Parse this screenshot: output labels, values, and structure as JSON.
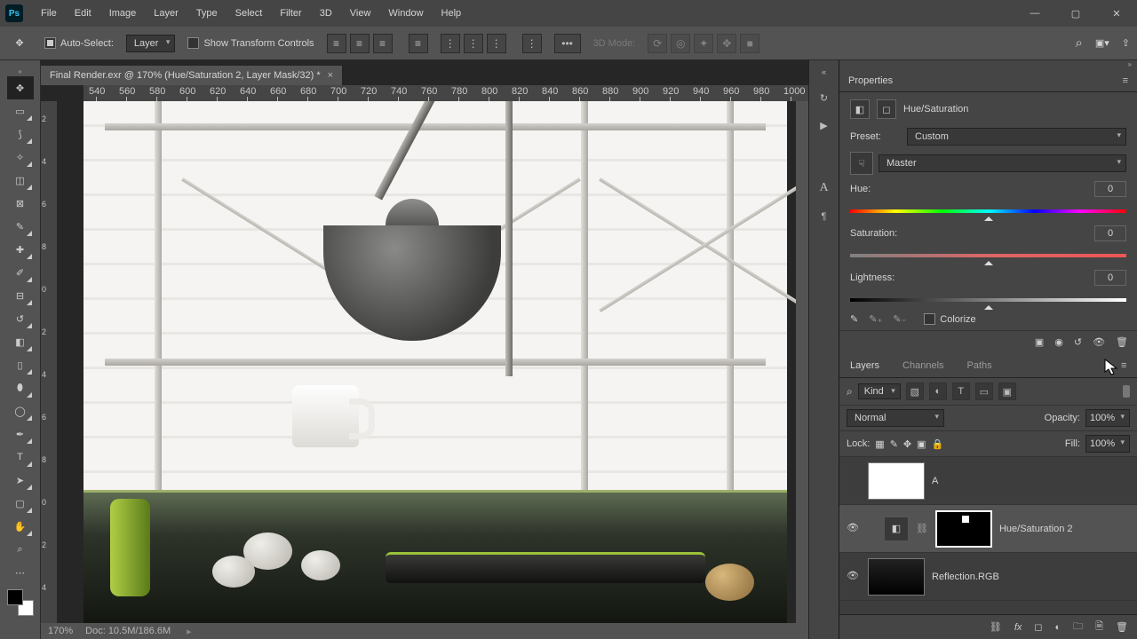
{
  "menubar": [
    "File",
    "Edit",
    "Image",
    "Layer",
    "Type",
    "Select",
    "Filter",
    "3D",
    "View",
    "Window",
    "Help"
  ],
  "optionbar": {
    "auto_select": "Auto-Select:",
    "auto_select_target": "Layer",
    "show_transform": "Show Transform Controls",
    "mode3d": "3D Mode:"
  },
  "document": {
    "tab_title": "Final Render.exr @ 170% (Hue/Saturation 2, Layer Mask/32) *",
    "zoom": "170%",
    "docsize": "Doc: 10.5M/186.6M"
  },
  "ruler_h": [
    540,
    580,
    620,
    640,
    660,
    680,
    700,
    720,
    740,
    760,
    780,
    800,
    820,
    840,
    860,
    880,
    900,
    920,
    940,
    960,
    980,
    1000
  ],
  "ruler_v": [
    2,
    4,
    6,
    8,
    0,
    2,
    4,
    6,
    8,
    0,
    2,
    4
  ],
  "tools": [
    {
      "name": "move",
      "glyph": "✥",
      "sel": true,
      "tri": false
    },
    {
      "name": "rect-marquee",
      "glyph": "▭",
      "tri": true
    },
    {
      "name": "lasso",
      "glyph": "⟆",
      "tri": true
    },
    {
      "name": "magic-wand",
      "glyph": "✧",
      "tri": true
    },
    {
      "name": "crop",
      "glyph": "◫",
      "tri": true
    },
    {
      "name": "frame",
      "glyph": "⊠",
      "tri": false
    },
    {
      "name": "eyedropper",
      "glyph": "✎",
      "tri": true
    },
    {
      "name": "spot-heal",
      "glyph": "✚",
      "tri": true
    },
    {
      "name": "brush",
      "glyph": "✐",
      "tri": true
    },
    {
      "name": "stamp",
      "glyph": "⊟",
      "tri": true
    },
    {
      "name": "history-brush",
      "glyph": "↺",
      "tri": true
    },
    {
      "name": "eraser",
      "glyph": "◧",
      "tri": true
    },
    {
      "name": "gradient",
      "glyph": "▯",
      "tri": true
    },
    {
      "name": "blur",
      "glyph": "⬮",
      "tri": true
    },
    {
      "name": "dodge",
      "glyph": "◯",
      "tri": true
    },
    {
      "name": "pen",
      "glyph": "✒",
      "tri": true
    },
    {
      "name": "type",
      "glyph": "T",
      "tri": true
    },
    {
      "name": "path-sel",
      "glyph": "➤",
      "tri": true
    },
    {
      "name": "rectangle",
      "glyph": "▢",
      "tri": true
    },
    {
      "name": "hand",
      "glyph": "✋",
      "tri": true
    },
    {
      "name": "zoom",
      "glyph": "⌕",
      "tri": false
    },
    {
      "name": "more",
      "glyph": "⋯",
      "tri": false
    }
  ],
  "properties": {
    "title": "Properties",
    "adjustment": "Hue/Saturation",
    "preset_label": "Preset:",
    "preset": "Custom",
    "channel": "Master",
    "hue_label": "Hue:",
    "hue": "0",
    "sat_label": "Saturation:",
    "sat": "0",
    "light_label": "Lightness:",
    "light": "0",
    "colorize": "Colorize"
  },
  "layers_panel": {
    "tabs": [
      "Layers",
      "Channels",
      "Paths"
    ],
    "filter_kind": "Kind",
    "blend": "Normal",
    "opacity_label": "Opacity:",
    "opacity": "100%",
    "lock_label": "Lock:",
    "fill_label": "Fill:",
    "fill": "100%",
    "layers": [
      {
        "name": "A"
      },
      {
        "name": "Hue/Saturation 2"
      },
      {
        "name": "Reflection.RGB"
      }
    ]
  }
}
